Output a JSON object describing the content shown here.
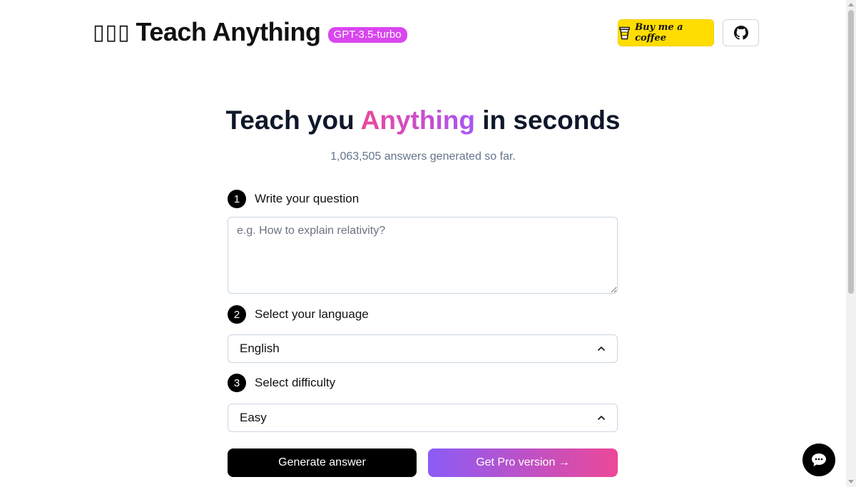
{
  "header": {
    "brand_emoji": "▯▯▯",
    "brand_title": "Teach Anything",
    "model_badge": "GPT-3.5-turbo",
    "coffee_label": "Buy me a coffee",
    "coffee_icon": "coffee-cup-icon",
    "github_icon": "github-icon"
  },
  "hero": {
    "title_before": "Teach you ",
    "title_highlight": "Anything",
    "title_after": " in seconds",
    "answers_count": "1,063,505 answers generated so far."
  },
  "form": {
    "step1": {
      "number": "1",
      "label": "Write your question"
    },
    "question_placeholder": "e.g. How to explain relativity?",
    "question_value": "",
    "step2": {
      "number": "2",
      "label": "Select your language"
    },
    "language_value": "English",
    "step3": {
      "number": "3",
      "label": "Select difficulty"
    },
    "difficulty_value": "Easy",
    "generate_label": "Generate answer",
    "pro_label": "Get Pro version →"
  },
  "chat": {
    "icon": "chat-bubble-icon"
  },
  "colors": {
    "badge": "#d946ef",
    "coffee_bg": "#ffdd00",
    "gradient_start": "#8b5cf6",
    "gradient_end": "#ec4899"
  }
}
